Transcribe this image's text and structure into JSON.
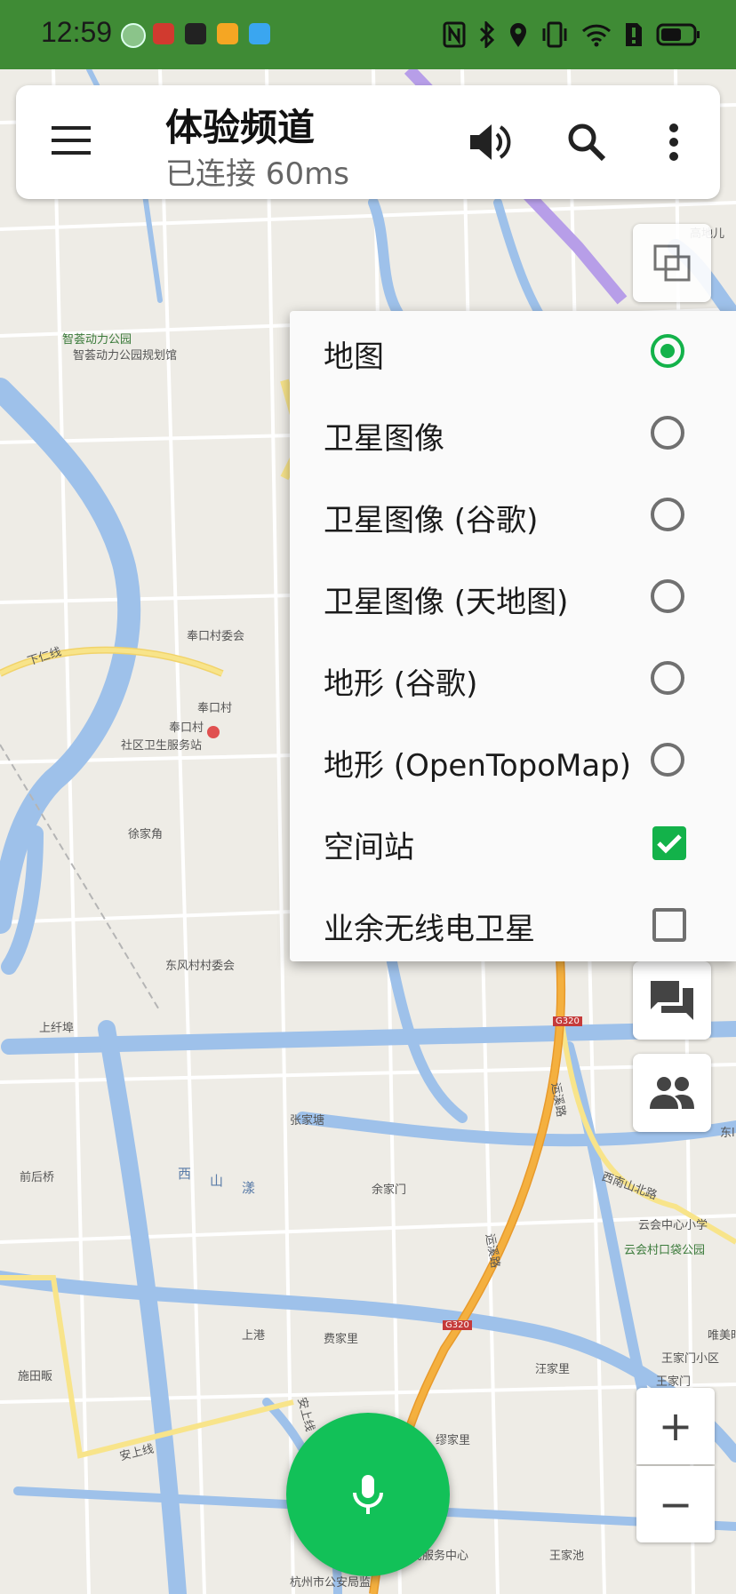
{
  "status_bar": {
    "time": "12:59",
    "notification_icons": [
      "app-icon-circle",
      "huawei-icon",
      "app-icon-pen",
      "weibo-icon",
      "weather-icon"
    ],
    "system_icons": [
      "nfc-icon",
      "bluetooth-icon",
      "location-icon",
      "vibrate-icon",
      "wifi-icon",
      "sim-alert-icon",
      "battery-icon"
    ]
  },
  "app_bar": {
    "title": "体验频道",
    "subtitle": "已连接 60ms",
    "icons": [
      "menu-icon",
      "volume-icon",
      "search-icon",
      "more-vert-icon"
    ]
  },
  "map_type_menu": {
    "options": [
      {
        "label": "地图",
        "control": "radio",
        "selected": true
      },
      {
        "label": "卫星图像",
        "control": "radio",
        "selected": false
      },
      {
        "label": "卫星图像 (谷歌)",
        "control": "radio",
        "selected": false
      },
      {
        "label": "卫星图像 (天地图)",
        "control": "radio",
        "selected": false
      },
      {
        "label": "地形 (谷歌)",
        "control": "radio",
        "selected": false
      },
      {
        "label": "地形 (OpenTopoMap)",
        "control": "radio",
        "selected": false
      },
      {
        "label": "空间站",
        "control": "checkbox",
        "checked": true
      },
      {
        "label": "业余无线电卫星",
        "control": "checkbox",
        "checked": false
      }
    ]
  },
  "map_labels": {
    "park": "智荟动力公园",
    "park_hall": "智荟动力公园规划馆",
    "committee1": "奉口村委会",
    "road_xiaren": "下仁线",
    "village1": "奉口村",
    "village1b": "奉口村",
    "clinic": "社区卫生服务站",
    "xujiajiao": "徐家角",
    "committee2": "东风村村委会",
    "shangqian": "上纤埠",
    "g320a": "G320",
    "zhangjiatang": "张家塘",
    "yujiamen": "余家门",
    "qianhouqiao": "前后桥",
    "xishanyang_a": "西",
    "xishanyang_b": "山",
    "xishanyang_c": "漾",
    "road_xinan": "西南山北路",
    "school": "云会中心小学",
    "park2": "云会村口袋公园",
    "shangang": "上港",
    "feijiali": "费家里",
    "g320b": "G320",
    "shitianfan": "施田畈",
    "road_anshang": "安上线",
    "road_anshang2": "安上线",
    "wangjiali": "汪家里",
    "wangjiamen_xq": "王家门小区",
    "wangjiamen": "王家门",
    "miaojiali": "缪家里",
    "service_center": "民服务中心",
    "wangjiachi": "王家池",
    "police": "杭州市公安局监",
    "weiyi": "唯美时",
    "dongle": "东l",
    "gaodi": "高地儿",
    "road_g": "运溪路",
    "road_h": "运溪路"
  },
  "side_buttons": [
    "layers-icon",
    "chat-icon",
    "group-icon"
  ],
  "zoom": {
    "in": "+",
    "out": "−"
  },
  "colors": {
    "accent": "#13b24a",
    "status_bar": "#3f8b35",
    "water": "#9ec1ea",
    "highway": "#f4b03f",
    "major_road": "#f8e48a"
  }
}
